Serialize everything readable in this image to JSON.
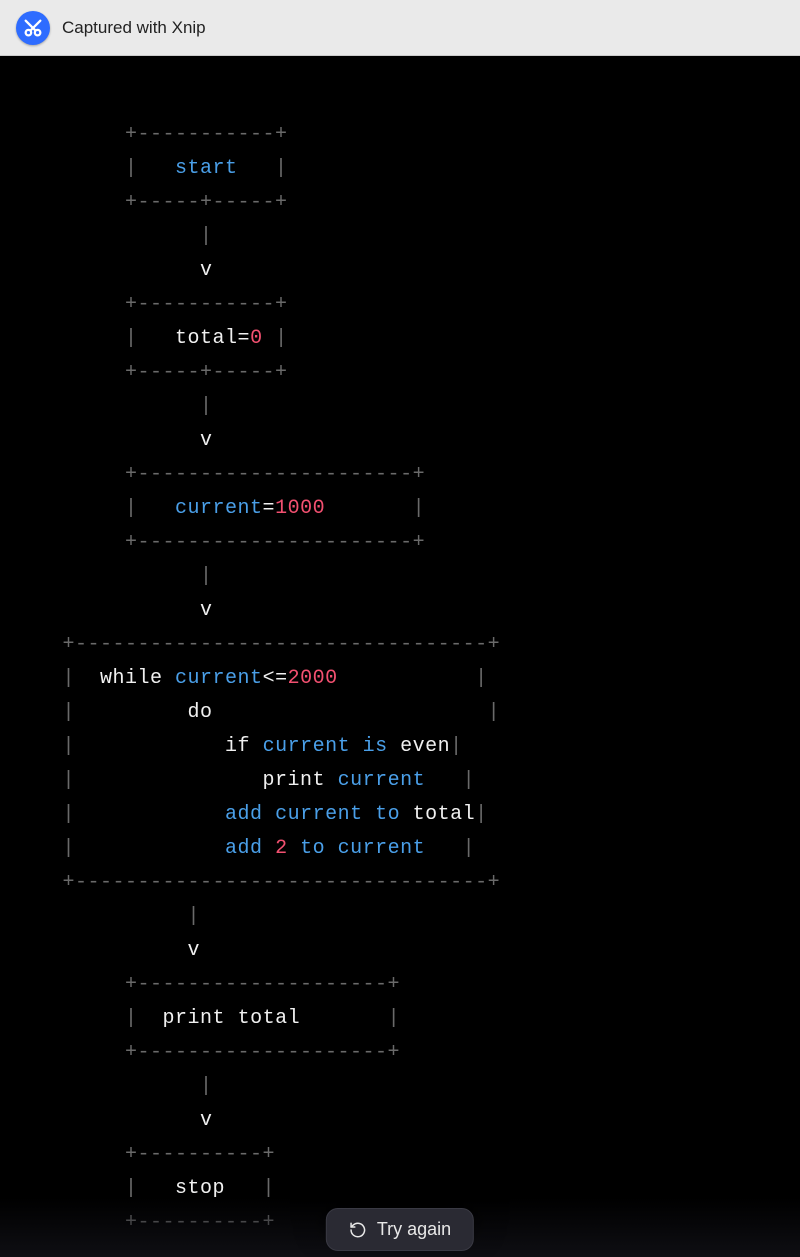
{
  "titlebar": {
    "app_name": "Captured with Xnip"
  },
  "diagram": {
    "l0": "          +-----------+",
    "l1a": "          |   ",
    "l1b": "start",
    "l1c": "   |",
    "l2": "          +-----+-----+",
    "l3": "                |",
    "l4": "                v",
    "l5": "          +-----------+",
    "l6a": "          |   ",
    "l6b": "total",
    "l6c": "=",
    "l6d": "0",
    "l6e": " |",
    "l7": "          +-----+-----+",
    "l8": "                |",
    "l9": "                v",
    "l10": "          +----------------------+",
    "l11a": "          |   ",
    "l11b": "current",
    "l11c": "=",
    "l11d": "1000",
    "l11e": "       |",
    "l12": "          +----------------------+",
    "l13": "                |",
    "l14": "                v",
    "l15": "     +---------------------------------+",
    "l16a": "     |  ",
    "l16b": "while",
    "l16c": " ",
    "l16d": "current",
    "l16e": "<=",
    "l16f": "2000",
    "l16g": "           |",
    "l17a": "     |         ",
    "l17b": "do",
    "l17c": "                      |",
    "l18a": "     |            ",
    "l18b": "if",
    "l18c": " ",
    "l18d": "current",
    "l18e": " ",
    "l18f": "is",
    "l18g": " ",
    "l18h": "even",
    "l18i": "|",
    "l19a": "     |               ",
    "l19b": "print",
    "l19c": " ",
    "l19d": "current",
    "l19e": "   |",
    "l20a": "     |            ",
    "l20b": "add",
    "l20c": " ",
    "l20d": "current",
    "l20e": " ",
    "l20f": "to",
    "l20g": " ",
    "l20h": "total",
    "l20i": "|",
    "l21a": "     |            ",
    "l21b": "add",
    "l21c": " ",
    "l21d": "2",
    "l21e": " ",
    "l21f": "to",
    "l21g": " ",
    "l21h": "current",
    "l21i": "   |",
    "l22": "     +---------------------------------+",
    "l23": "               |",
    "l24": "               v",
    "l25": "          +--------------------+",
    "l26a": "          |  ",
    "l26b": "print",
    "l26c": " ",
    "l26d": "total",
    "l26e": "       |",
    "l27": "          +--------------------+",
    "l28": "                |",
    "l29": "                v",
    "l30": "          +----------+",
    "l31a": "          |   ",
    "l31b": "stop",
    "l31c": "   |",
    "l32": "          +----------+"
  },
  "footer": {
    "try_again": "Try again"
  }
}
